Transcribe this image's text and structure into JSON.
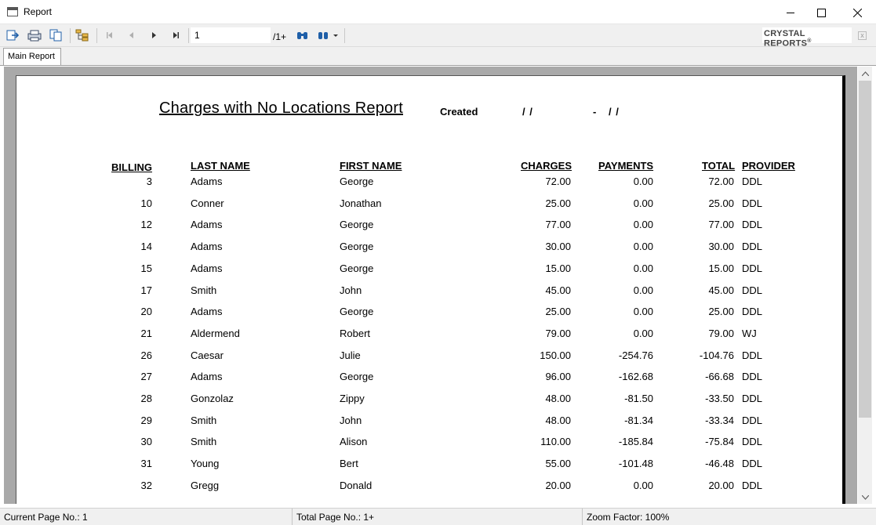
{
  "window": {
    "title": "Report"
  },
  "toolbar": {
    "page_value": "1",
    "page_total": "/1+",
    "brand": "CRYSTAL REPORTS",
    "brand_mark": "®",
    "brand_close": "x"
  },
  "tabs": [
    {
      "label": "Main Report"
    }
  ],
  "report": {
    "title": "Charges with No Locations Report",
    "created_label": "Created",
    "date_start": "/ /",
    "date_separator": "-",
    "date_end": "/ /",
    "columns": {
      "billing": "BILLING",
      "last_name": "LAST NAME",
      "first_name": "FIRST NAME",
      "charges": "CHARGES",
      "payments": "PAYMENTS",
      "total": "TOTAL",
      "provider": "PROVIDER"
    },
    "rows": [
      {
        "billing": "3",
        "last": "Adams",
        "first": "George",
        "charges": "72.00",
        "payments": "0.00",
        "total": "72.00",
        "provider": "DDL"
      },
      {
        "billing": "10",
        "last": "Conner",
        "first": "Jonathan",
        "charges": "25.00",
        "payments": "0.00",
        "total": "25.00",
        "provider": "DDL"
      },
      {
        "billing": "12",
        "last": "Adams",
        "first": "George",
        "charges": "77.00",
        "payments": "0.00",
        "total": "77.00",
        "provider": "DDL"
      },
      {
        "billing": "14",
        "last": "Adams",
        "first": "George",
        "charges": "30.00",
        "payments": "0.00",
        "total": "30.00",
        "provider": "DDL"
      },
      {
        "billing": "15",
        "last": "Adams",
        "first": "George",
        "charges": "15.00",
        "payments": "0.00",
        "total": "15.00",
        "provider": "DDL"
      },
      {
        "billing": "17",
        "last": "Smith",
        "first": "John",
        "charges": "45.00",
        "payments": "0.00",
        "total": "45.00",
        "provider": "DDL"
      },
      {
        "billing": "20",
        "last": "Adams",
        "first": "George",
        "charges": "25.00",
        "payments": "0.00",
        "total": "25.00",
        "provider": "DDL"
      },
      {
        "billing": "21",
        "last": "Aldermend",
        "first": "Robert",
        "charges": "79.00",
        "payments": "0.00",
        "total": "79.00",
        "provider": "WJ"
      },
      {
        "billing": "26",
        "last": "Caesar",
        "first": "Julie",
        "charges": "150.00",
        "payments": "-254.76",
        "total": "-104.76",
        "provider": "DDL"
      },
      {
        "billing": "27",
        "last": "Adams",
        "first": "George",
        "charges": "96.00",
        "payments": "-162.68",
        "total": "-66.68",
        "provider": "DDL"
      },
      {
        "billing": "28",
        "last": "Gonzolaz",
        "first": "Zippy",
        "charges": "48.00",
        "payments": "-81.50",
        "total": "-33.50",
        "provider": "DDL"
      },
      {
        "billing": "29",
        "last": "Smith",
        "first": "John",
        "charges": "48.00",
        "payments": "-81.34",
        "total": "-33.34",
        "provider": "DDL"
      },
      {
        "billing": "30",
        "last": "Smith",
        "first": "Alison",
        "charges": "110.00",
        "payments": "-185.84",
        "total": "-75.84",
        "provider": "DDL"
      },
      {
        "billing": "31",
        "last": "Young",
        "first": "Bert",
        "charges": "55.00",
        "payments": "-101.48",
        "total": "-46.48",
        "provider": "DDL"
      },
      {
        "billing": "32",
        "last": "Gregg",
        "first": "Donald",
        "charges": "20.00",
        "payments": "0.00",
        "total": "20.00",
        "provider": "DDL"
      }
    ]
  },
  "status": {
    "current_page": "Current Page No.: 1",
    "total_page": "Total Page No.: 1+",
    "zoom": "Zoom Factor: 100%"
  },
  "colors": {
    "viewport_bg": "#a9a9a9",
    "chrome_bg": "#f0f0f0",
    "icon_blue": "#1f5fa8"
  },
  "icons": [
    "export-icon",
    "print-icon",
    "copy-icon",
    "group-tree-icon",
    "first-page-icon",
    "previous-page-icon",
    "next-page-icon",
    "last-page-icon",
    "find-icon",
    "zoom-icon"
  ]
}
